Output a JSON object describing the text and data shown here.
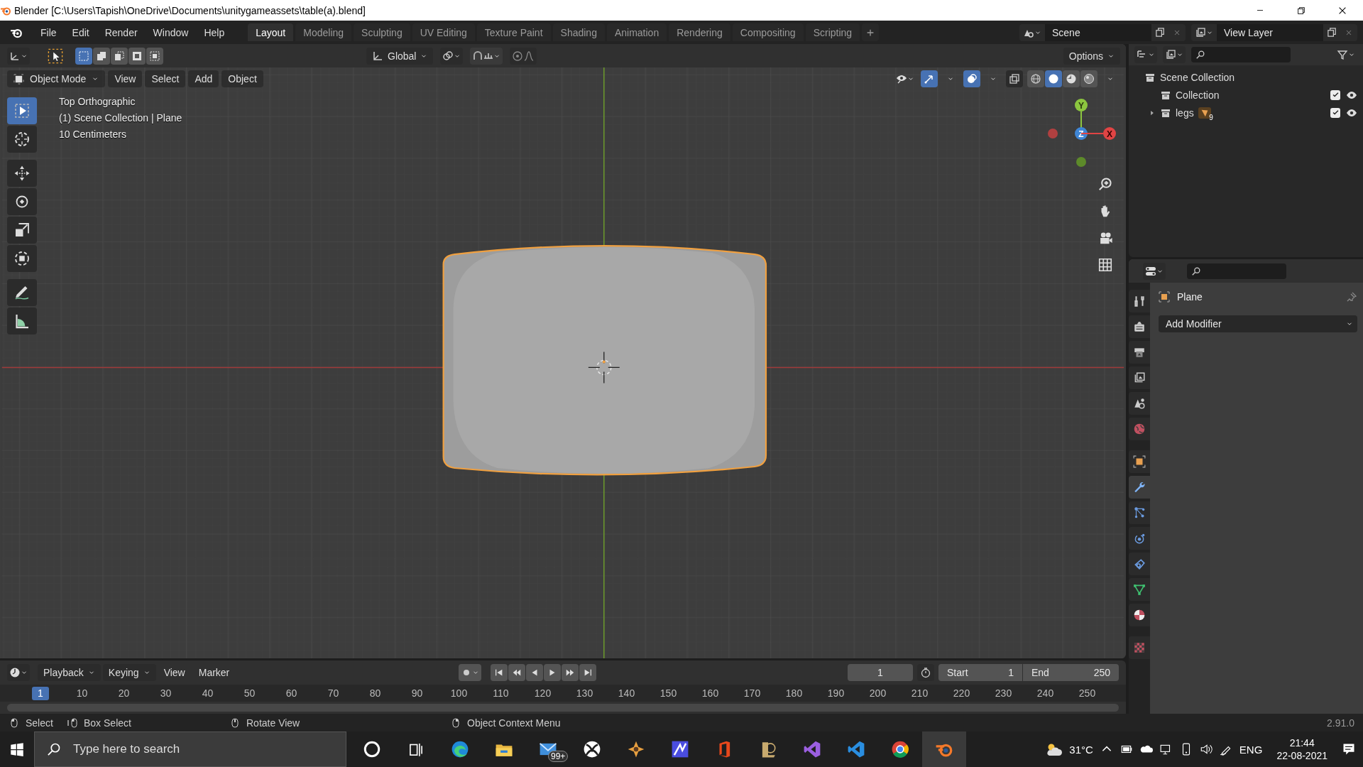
{
  "window": {
    "title": "Blender [C:\\Users\\Tapish\\OneDrive\\Documents\\unitygameassets\\table(a).blend]",
    "controls": [
      {
        "kind": "minimize"
      },
      {
        "kind": "maximize"
      },
      {
        "kind": "close"
      }
    ]
  },
  "menu": [
    "File",
    "Edit",
    "Render",
    "Window",
    "Help"
  ],
  "workspaces": [
    {
      "label": "Layout",
      "selected": true
    },
    {
      "label": "Modeling",
      "selected": false
    },
    {
      "label": "Sculpting",
      "selected": false
    },
    {
      "label": "UV Editing",
      "selected": false
    },
    {
      "label": "Texture Paint",
      "selected": false
    },
    {
      "label": "Shading",
      "selected": false
    },
    {
      "label": "Animation",
      "selected": false
    },
    {
      "label": "Rendering",
      "selected": false
    },
    {
      "label": "Compositing",
      "selected": false
    },
    {
      "label": "Scripting",
      "selected": false
    }
  ],
  "scene": "Scene",
  "view_layer": "View Layer",
  "tool_header": {
    "select_modes": [
      {
        "kind": "new",
        "selected": true
      },
      {
        "kind": "extend",
        "selected": false
      },
      {
        "kind": "subtract",
        "selected": false
      },
      {
        "kind": "invert",
        "selected": false
      },
      {
        "kind": "intersect",
        "selected": false
      }
    ],
    "orientation": "Global",
    "options": "Options"
  },
  "viewport": {
    "mode": "Object Mode",
    "menus": [
      "View",
      "Select",
      "Add",
      "Object"
    ],
    "gizmos_on": true,
    "overlays_on": true,
    "shading": [
      {
        "kind": "wireframe",
        "selected": false
      },
      {
        "kind": "solid",
        "selected": true
      },
      {
        "kind": "material",
        "selected": false
      },
      {
        "kind": "rendered",
        "selected": false
      }
    ],
    "info": [
      "Top Orthographic",
      "(1) Scene Collection | Plane",
      "10 Centimeters"
    ],
    "tools": [
      {
        "kind": "select",
        "selected": true
      },
      {
        "kind": "cursor",
        "selected": false
      },
      {
        "kind": "move",
        "selected": false
      },
      {
        "kind": "rotate",
        "selected": false
      },
      {
        "kind": "scale",
        "selected": false
      },
      {
        "kind": "transform",
        "selected": false
      },
      {
        "kind": "annotate",
        "selected": false
      },
      {
        "kind": "measure",
        "selected": false
      }
    ],
    "gizmo_axes": [
      {
        "kind": "y",
        "label": "Y"
      },
      {
        "kind": "z",
        "label": "Z"
      },
      {
        "kind": "x",
        "label": "X"
      }
    ]
  },
  "outliner": {
    "items": [
      {
        "label": "Scene Collection",
        "children": [
          {
            "label": "Collection",
            "checked": true,
            "visible": true
          },
          {
            "label": "legs",
            "expanded": false,
            "checked": true,
            "visible": true,
            "badge": "9"
          }
        ]
      }
    ]
  },
  "properties": {
    "tabs": [
      {
        "kind": "tool",
        "selected": false
      },
      {
        "kind": "render",
        "selected": false
      },
      {
        "kind": "output",
        "selected": false
      },
      {
        "kind": "view-layer",
        "selected": false
      },
      {
        "kind": "scene",
        "selected": false
      },
      {
        "kind": "world",
        "selected": false
      },
      {
        "kind": "object",
        "selected": false
      },
      {
        "kind": "modifier",
        "selected": true
      },
      {
        "kind": "particles",
        "selected": false
      },
      {
        "kind": "physics",
        "selected": false
      },
      {
        "kind": "constraints",
        "selected": false
      },
      {
        "kind": "data",
        "selected": false
      },
      {
        "kind": "material",
        "selected": false
      },
      {
        "kind": "texture",
        "selected": false
      }
    ],
    "object": "Plane",
    "add_modifier": "Add Modifier"
  },
  "timeline": {
    "menus": [
      "Playback",
      "Keying",
      "View",
      "Marker"
    ],
    "current_frame": "1",
    "start_label": "Start",
    "start": "1",
    "end_label": "End",
    "end": "250",
    "ruler": [
      {
        "label": "1",
        "selected": true
      },
      {
        "label": "10",
        "selected": false
      },
      {
        "label": "20",
        "selected": false
      },
      {
        "label": "30",
        "selected": false
      },
      {
        "label": "40",
        "selected": false
      },
      {
        "label": "50",
        "selected": false
      },
      {
        "label": "60",
        "selected": false
      },
      {
        "label": "70",
        "selected": false
      },
      {
        "label": "80",
        "selected": false
      },
      {
        "label": "90",
        "selected": false
      },
      {
        "label": "100",
        "selected": false
      },
      {
        "label": "110",
        "selected": false
      },
      {
        "label": "120",
        "selected": false
      },
      {
        "label": "130",
        "selected": false
      },
      {
        "label": "140",
        "selected": false
      },
      {
        "label": "150",
        "selected": false
      },
      {
        "label": "160",
        "selected": false
      },
      {
        "label": "170",
        "selected": false
      },
      {
        "label": "180",
        "selected": false
      },
      {
        "label": "190",
        "selected": false
      },
      {
        "label": "200",
        "selected": false
      },
      {
        "label": "210",
        "selected": false
      },
      {
        "label": "220",
        "selected": false
      },
      {
        "label": "230",
        "selected": false
      },
      {
        "label": "240",
        "selected": false
      },
      {
        "label": "250",
        "selected": false
      }
    ]
  },
  "status_bar": {
    "hints": [
      {
        "kind": "mouse-left",
        "label": "Select"
      },
      {
        "kind": "mouse-drag",
        "label": "Box Select"
      },
      {
        "kind": "mouse-middle",
        "label": "Rotate View"
      },
      {
        "kind": "mouse-right",
        "label": "Object Context Menu"
      }
    ],
    "version": "2.91.0"
  },
  "taskbar": {
    "search": {
      "placeholder": "Type here to search"
    },
    "apps": [
      {
        "kind": "cortana",
        "active": false
      },
      {
        "kind": "taskview",
        "active": false
      },
      {
        "kind": "edge",
        "active": false
      },
      {
        "kind": "folder",
        "active": false
      },
      {
        "kind": "mail",
        "active": false,
        "badge": "99+"
      },
      {
        "kind": "xbox",
        "active": false
      },
      {
        "kind": "puzzle",
        "active": false
      },
      {
        "kind": "purple",
        "active": false
      },
      {
        "kind": "office",
        "active": false
      },
      {
        "kind": "league",
        "active": false
      },
      {
        "kind": "vs",
        "active": false
      },
      {
        "kind": "vscode",
        "active": false
      },
      {
        "kind": "chrome",
        "active": false
      },
      {
        "kind": "blender",
        "active": true
      }
    ],
    "weather": "31°C",
    "language": "ENG",
    "time": "21:44",
    "date": "22-08-2021"
  }
}
